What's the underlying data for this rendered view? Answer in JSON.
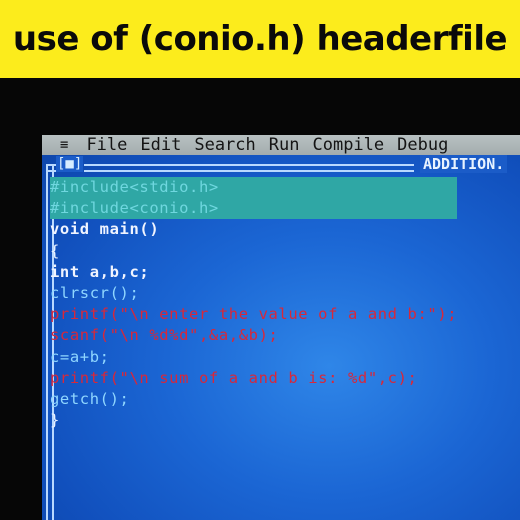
{
  "banner": {
    "title": "use of (conio.h) headerfile"
  },
  "ide": {
    "menu": {
      "system_icon": "≡",
      "items": [
        "File",
        "Edit",
        "Search",
        "Run",
        "Compile",
        "Debug"
      ]
    },
    "window": {
      "close_box": "[■]",
      "title": "ADDITION."
    },
    "code": [
      {
        "text": "#include<stdio.h>"
      },
      {
        "text": "#include<conio.h>"
      },
      {
        "text": "void main()"
      },
      {
        "text": "{"
      },
      {
        "text": "int a,b,c;"
      },
      {
        "text": "clrscr();"
      },
      {
        "text": "printf(\"\\n enter the value of a and b:\");"
      },
      {
        "text": "scanf(\"\\n %d%d\",&a,&b);"
      },
      {
        "text": "c=a+b;"
      },
      {
        "text": "printf(\"\\n sum of a and b is: %d\",c);"
      },
      {
        "text": "getch();"
      },
      {
        "text": "}"
      }
    ]
  },
  "colors": {
    "banner_bg": "#fcec1c",
    "screen_bg": "#1b66d4",
    "menubar_bg": "#b1babb",
    "include_highlight": "#2fa7a5",
    "string": "#d8283a"
  }
}
